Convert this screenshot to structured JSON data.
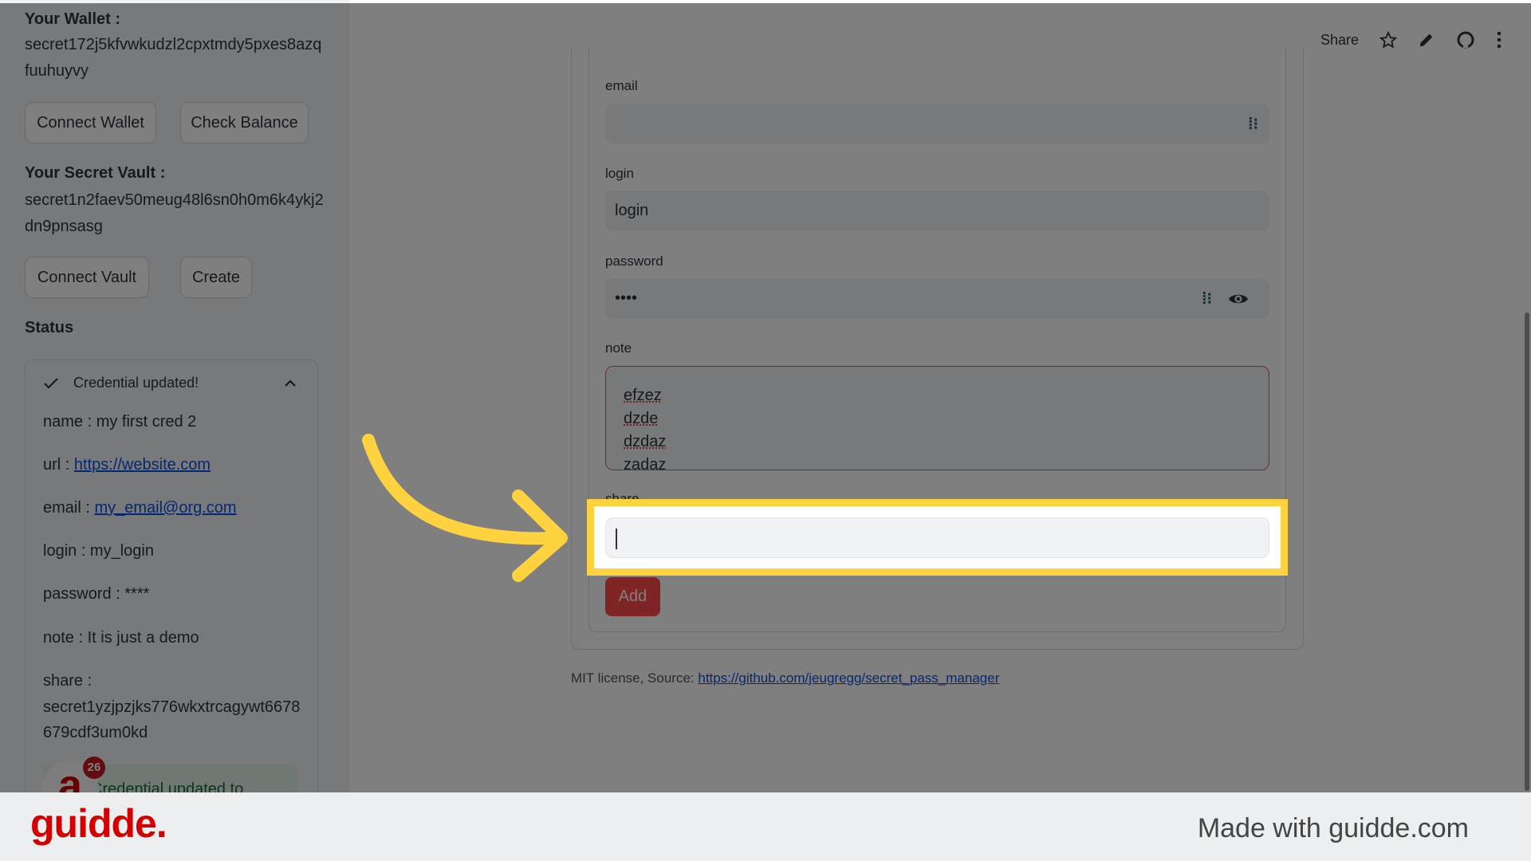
{
  "sidebar": {
    "wallet_label": "Your Wallet :",
    "wallet_addr_1": "secret172j5kfvwkudzl2cpxtmdy5pxes8azq",
    "wallet_addr_2": "fuuhuyvy",
    "connect_wallet": "Connect Wallet",
    "check_balance": "Check Balance",
    "vault_label": "Your Secret Vault :",
    "vault_addr_1": "secret1n2faev50meug48l6sn0h0m6k4ykj2",
    "vault_addr_2": "dn9pnsasg",
    "connect_vault": "Connect Vault",
    "create": "Create",
    "status_label": "Status",
    "status": {
      "title": "Credential updated!",
      "name": "name : my first cred 2",
      "url_prefix": "url : ",
      "url": "https://website.com",
      "email_prefix": "email : ",
      "email": "my_email@org.com",
      "login": "login : my_login",
      "password": "password : ****",
      "note": "note : It is just a demo",
      "share_label": "share :",
      "share_1": "secret1yzjpzjks776wkxtrcagywt6678",
      "share_2": "679cdf3um0kd",
      "toast": "Credential updated to",
      "badge": "26"
    }
  },
  "header": {
    "share": "Share",
    "icons": [
      "star-icon",
      "pencil-icon",
      "github-icon",
      "more-vertical-icon"
    ]
  },
  "form": {
    "email_label": "email",
    "email_value": "",
    "login_label": "login",
    "login_value": "login",
    "password_label": "password",
    "password_value": "••••",
    "note_label": "note",
    "note_lines": [
      "efzez",
      "dzde",
      "dzdaz",
      "zadaz"
    ],
    "share_label": "share",
    "share_value": "",
    "add": "Add"
  },
  "footer": {
    "prefix": "MIT license, Source: ",
    "link": "https://github.com/jeugregg/secret_pass_manager"
  },
  "brand": {
    "logo": "guidde.",
    "made_with": "Made with guidde.com",
    "highlight_color": "#ffd23f",
    "accent": "#ff4b4b"
  }
}
